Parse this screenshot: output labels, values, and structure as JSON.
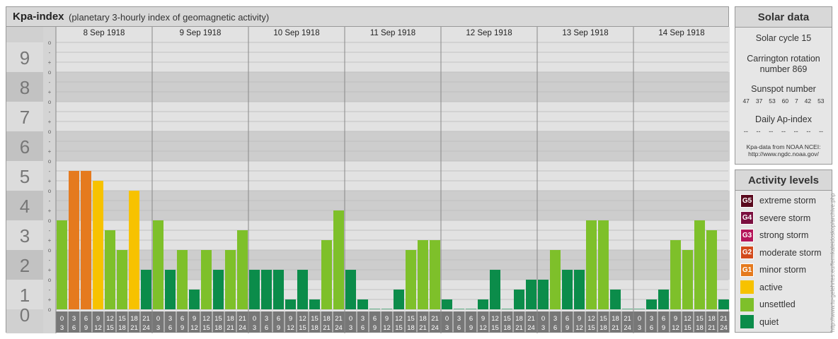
{
  "header": {
    "title": "Kpa-index",
    "subtitle": "(planetary 3-hourly index of geomagnetic activity)"
  },
  "chart_data": {
    "type": "bar",
    "title": "Kpa-index",
    "subtitle": "(planetary 3-hourly index of geomagnetic activity)",
    "ylim": [
      0,
      9
    ],
    "y_ticks": [
      "0",
      "1",
      "2",
      "3",
      "4",
      "5",
      "6",
      "7",
      "8",
      "9"
    ],
    "minor_ticks": [
      "o",
      "+",
      "-"
    ],
    "days": [
      "8 Sep 1918",
      "9 Sep 1918",
      "10 Sep 1918",
      "11 Sep 1918",
      "12 Sep 1918",
      "13 Sep 1918",
      "14 Sep 1918"
    ],
    "intervals": [
      [
        "0",
        "3"
      ],
      [
        "3",
        "6"
      ],
      [
        "6",
        "9"
      ],
      [
        "9",
        "12"
      ],
      [
        "12",
        "15"
      ],
      [
        "15",
        "18"
      ],
      [
        "18",
        "21"
      ],
      [
        "21",
        "24"
      ]
    ],
    "series": [
      {
        "values": [
          3,
          4.667,
          4.667,
          4.333,
          2.667,
          2,
          4,
          1.333,
          3,
          1.333,
          2,
          0.667,
          2,
          1.333,
          2,
          2.667,
          1.333,
          1.333,
          1.333,
          0.333,
          1.333,
          0.333,
          2.333,
          3.333,
          1.333,
          0.333,
          0,
          0,
          0.667,
          2,
          2.333,
          2.333,
          0.333,
          0,
          0,
          0.333,
          1.333,
          0,
          0.667,
          1,
          1,
          2,
          1.333,
          1.333,
          3,
          3,
          0.667,
          0,
          0,
          0.333,
          0.667,
          2.333,
          2,
          3,
          2.667,
          0.333
        ]
      }
    ],
    "grid": true
  },
  "solar": {
    "title": "Solar data",
    "cycle": "Solar cycle 15",
    "carrington_line1": "Carrington rotation",
    "carrington_line2": "number 869",
    "sunspot_label": "Sunspot number",
    "sunspots": [
      "47",
      "37",
      "53",
      "60",
      "7",
      "42",
      "53"
    ],
    "ap_label": "Daily Ap-index",
    "ap_values": [
      "--",
      "--",
      "--",
      "--",
      "--",
      "--",
      "--"
    ],
    "source_line1": "Kpa-data from NOAA NCEI:",
    "source_line2": "http://www.ngdc.noaa.gov/"
  },
  "activity": {
    "title": "Activity levels",
    "levels": [
      {
        "badge": "G5",
        "label": "extreme storm",
        "color": "#5a0a1e"
      },
      {
        "badge": "G4",
        "label": "severe storm",
        "color": "#7b1040"
      },
      {
        "badge": "G3",
        "label": "strong storm",
        "color": "#b5165a"
      },
      {
        "badge": "G2",
        "label": "moderate storm",
        "color": "#d24a1c"
      },
      {
        "badge": "G1",
        "label": "minor storm",
        "color": "#e57a1e"
      },
      {
        "badge": "",
        "label": "active",
        "color": "#f7c200"
      },
      {
        "badge": "",
        "label": "unsettled",
        "color": "#7ec02a"
      },
      {
        "badge": "",
        "label": "quiet",
        "color": "#0b8c4a"
      }
    ]
  },
  "colors": {
    "quiet": "#0b8c4a",
    "unsettled": "#7ec02a",
    "active": "#f7c200",
    "minor_storm": "#e57a1e"
  },
  "watermark": "http://www.tu-gelehrtes.eu/fermkaleidoskop/archive.php"
}
